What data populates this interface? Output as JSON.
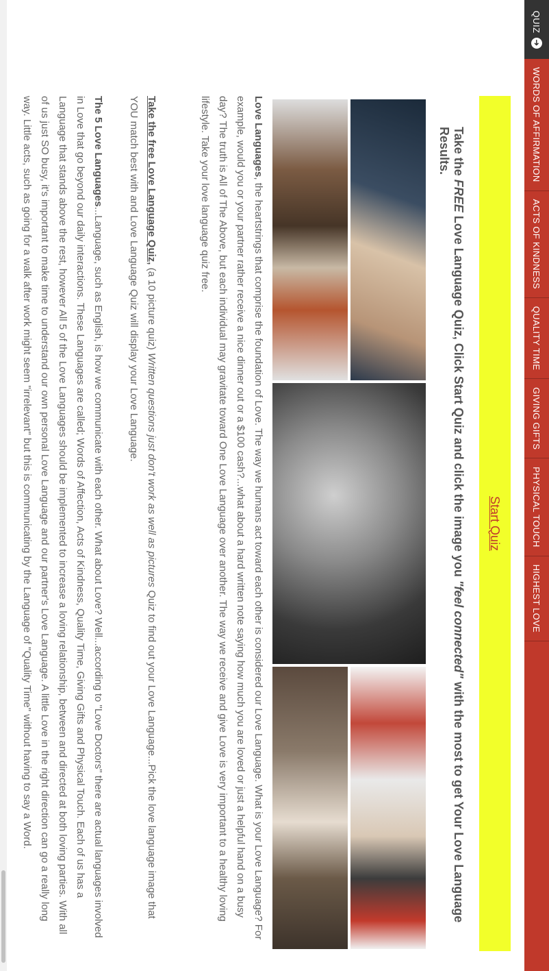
{
  "nav": {
    "quiz_label": "QUIZ",
    "quiz_icon": "arrow-circle-icon",
    "items": [
      "WORDS OF AFFIRMATION",
      "ACTS OF KINDNESS",
      "QUALITY TIME",
      "GIVING GIFTS",
      "PHYSICAL TOUCH",
      "HIGHEST LOVE"
    ]
  },
  "banner": {
    "start_quiz": "Start Quiz",
    "color": "#f2ff2a"
  },
  "heading": {
    "prefix": "Take the ",
    "free": "FREE",
    "middle": " Love Language Quiz, Click Start Quiz and click the image you ",
    "feel": "\"feel connected\"",
    "suffix": " with the most to get Your Love Language Results."
  },
  "collage": {
    "tiles": [
      {
        "name": "money-handoff-photo"
      },
      {
        "name": "couple-street-photo"
      },
      {
        "name": "holding-hands-photo"
      },
      {
        "name": "kitchen-couple-photo"
      },
      {
        "name": "reading-couple-photo"
      }
    ]
  },
  "p1": {
    "bold": "Love Languages",
    "text": ", the heartstrings that comprise the foundation of Love. The way we humans act toward each other is considered our Love Language. What is your Love Language? For example, would you or your partner rather receive a nice dinner out or a $100 cash?...what about a hard written note saying how much you are loved or just a helpful hand on a busy day? The truth is All of The Above, but each individual may gravitate toward One Love Language over another. The way we receive and give Love is very important to a healthy loving lifestyle. Take your love language quiz free."
  },
  "p2": {
    "link": "Take the free Love Language Quiz,",
    "mid": " (a 10 picture quiz) ",
    "italic": "Written questions just don't work as well as pictures",
    "text": " Quiz to find out your Love Language...Pick the love language image that YOU match best with and Love Language Quiz will display your Love Language."
  },
  "p3": {
    "bold": "The 5 Love Languages",
    "text": "...Language, such as English, is how we communicate with each other. What about Love? Well...according to \"Love Doctors\" there are actual languages involved in Love that go beyond our daily interactions. These Languages are called; Words of Affection, Acts of Kindness, Quality Time, Giving Gifts and Physical Touch. Each of us has a Language that stands above the rest, however All 5 of the Love Languages should be implemented to increase a loving relationship, between and directed at both loving parties. With all of us just SO busy, it's important to make time to understand our own personal Love Language and our partner's Love Language. A little Love in the right direction can go a really long way. Little acts, such as going for a walk after work might seem \"irrelevant\" but this is communicating by the Language of \"Quality Time\" without having to say a Word."
  }
}
